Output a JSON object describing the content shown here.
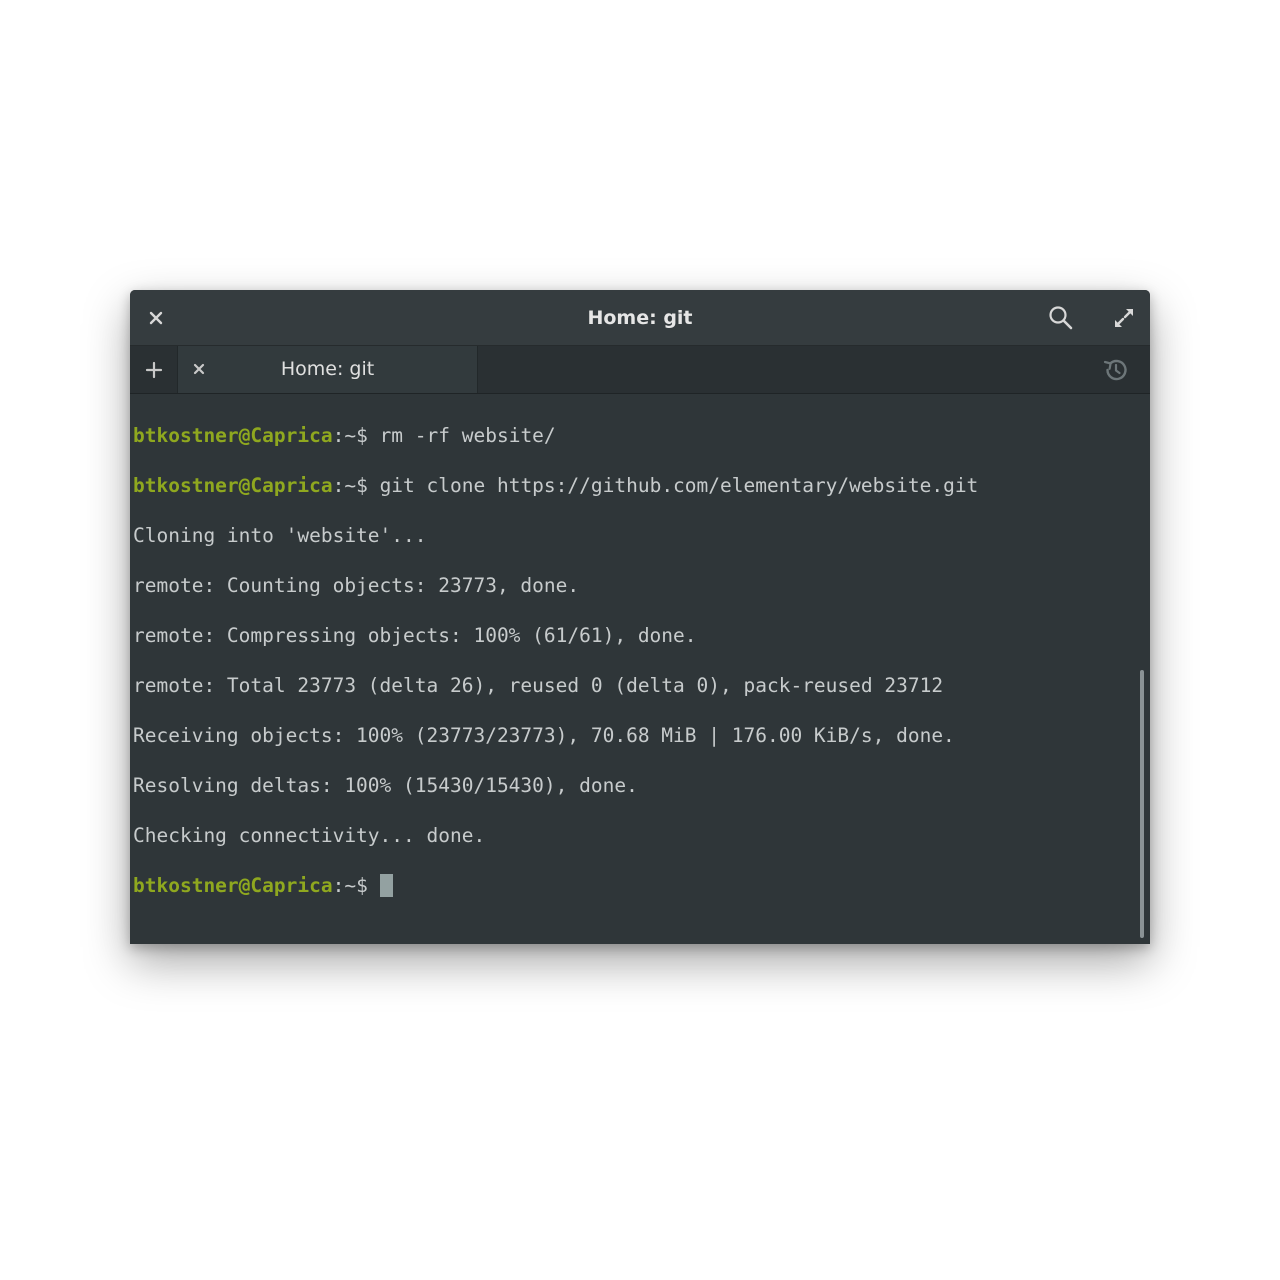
{
  "window": {
    "title": "Home: git"
  },
  "tabs": [
    {
      "label": "Home: git"
    }
  ],
  "colors": {
    "background": "#2f3639",
    "prompt": "#8fa81f",
    "text": "#c7cbcc"
  },
  "terminal": {
    "lines": [
      {
        "user": "btkostner@Caprica",
        "path": ":~$ ",
        "command": "rm -rf website/"
      },
      {
        "user": "btkostner@Caprica",
        "path": ":~$ ",
        "command": "git clone https://github.com/elementary/website.git"
      },
      {
        "text": "Cloning into 'website'..."
      },
      {
        "text": "remote: Counting objects: 23773, done."
      },
      {
        "text": "remote: Compressing objects: 100% (61/61), done."
      },
      {
        "text": "remote: Total 23773 (delta 26), reused 0 (delta 0), pack-reused 23712"
      },
      {
        "text": "Receiving objects: 100% (23773/23773), 70.68 MiB | 176.00 KiB/s, done."
      },
      {
        "text": "Resolving deltas: 100% (15430/15430), done."
      },
      {
        "text": "Checking connectivity... done."
      },
      {
        "user": "btkostner@Caprica",
        "path": ":~$ ",
        "command": ""
      }
    ]
  },
  "icons": {
    "close": "close-icon",
    "search": "search-icon",
    "maximize": "maximize-icon",
    "new_tab": "plus-icon",
    "tab_close": "close-icon",
    "history": "history-icon"
  }
}
